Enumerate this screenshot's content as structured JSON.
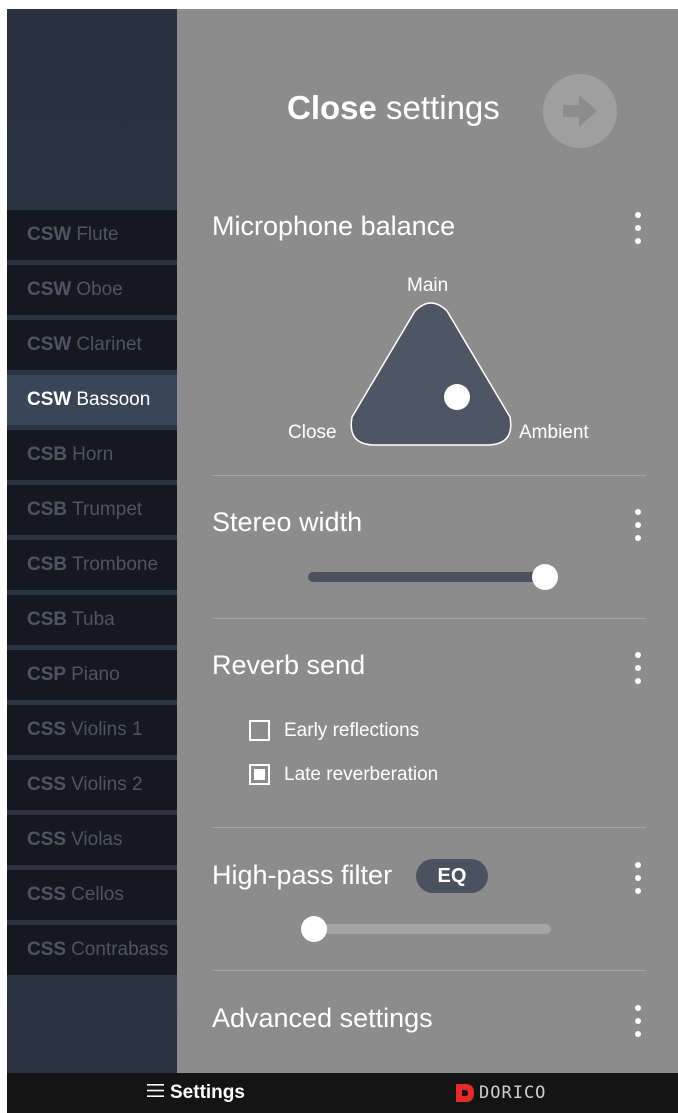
{
  "sidebar": {
    "items": [
      {
        "prefix": "CSW",
        "name": "Flute"
      },
      {
        "prefix": "CSW",
        "name": "Oboe"
      },
      {
        "prefix": "CSW",
        "name": "Clarinet"
      },
      {
        "prefix": "CSW",
        "name": "Bassoon",
        "selected": true
      },
      {
        "prefix": "CSB",
        "name": "Horn"
      },
      {
        "prefix": "CSB",
        "name": "Trumpet"
      },
      {
        "prefix": "CSB",
        "name": "Trombone"
      },
      {
        "prefix": "CSB",
        "name": "Tuba"
      },
      {
        "prefix": "CSP",
        "name": "Piano"
      },
      {
        "prefix": "CSS",
        "name": "Violins 1"
      },
      {
        "prefix": "CSS",
        "name": "Violins 2"
      },
      {
        "prefix": "CSS",
        "name": "Violas"
      },
      {
        "prefix": "CSS",
        "name": "Cellos"
      },
      {
        "prefix": "CSS",
        "name": "Contrabass"
      }
    ]
  },
  "header": {
    "close_bold": "Close",
    "close_rest": "settings",
    "close_icon": "arrow-right-icon"
  },
  "microphone": {
    "title": "Microphone balance",
    "label_main": "Main",
    "label_close": "Close",
    "label_ambient": "Ambient"
  },
  "stereo": {
    "title": "Stereo width",
    "value": 1.0
  },
  "reverb": {
    "title": "Reverb send",
    "early_label": "Early reflections",
    "early_checked": false,
    "late_label": "Late reverberation",
    "late_checked": true
  },
  "highpass": {
    "title": "High-pass filter",
    "eq_label": "EQ",
    "value": 0.0
  },
  "advanced": {
    "title": "Advanced settings"
  },
  "bottombar": {
    "settings_label": "Settings",
    "logo_text": "DORICO"
  },
  "colors": {
    "panel_bg": "#8c8c8c",
    "sidebar_item_bg": "#151820",
    "sidebar_active_bg": "#3a4556",
    "triangle_fill": "#4f5663",
    "track_dark": "#4a5260",
    "track_light": "#a5a5a5",
    "logo_red": "#e52a2a"
  }
}
